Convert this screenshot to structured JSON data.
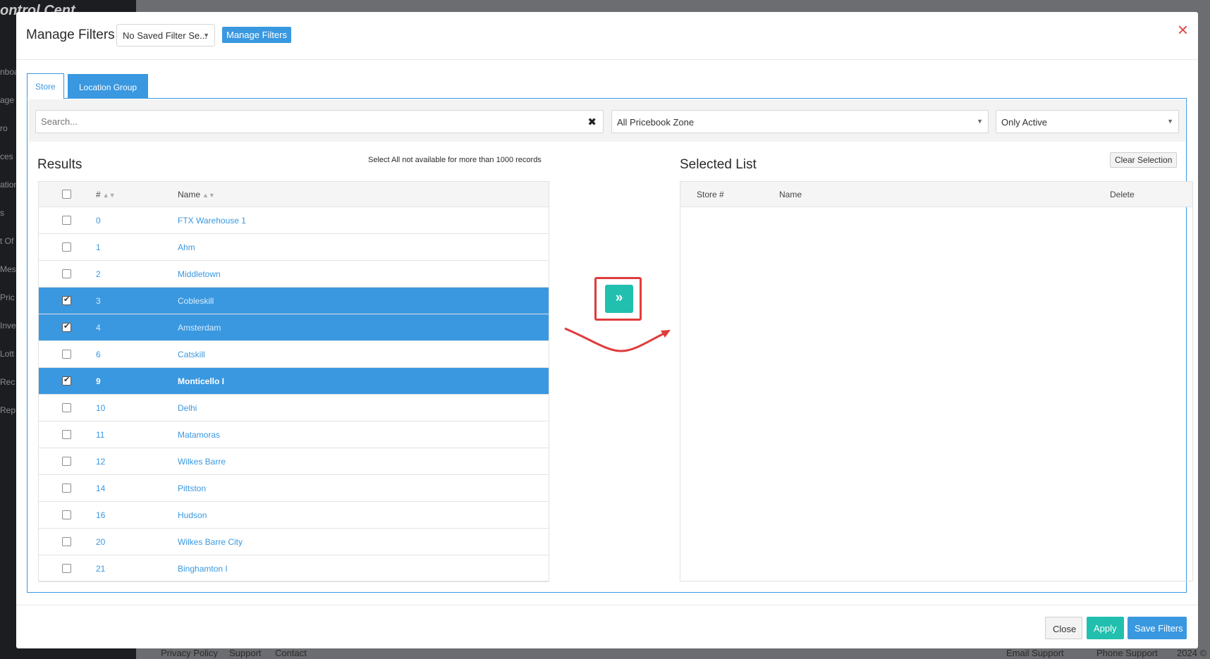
{
  "background": {
    "brand": "ontrol Cent",
    "sidebar_items": [
      "nboa",
      "age",
      "ro",
      "ces",
      "ation",
      "s",
      "t Of",
      "Mes",
      "Pric",
      "Inve",
      "Lott",
      "Rec",
      "Rep"
    ],
    "footer_links": [
      "Privacy Policy",
      "Support",
      "Contact"
    ],
    "footer_right": [
      "Email Support",
      "Phone Support",
      "2024 ©"
    ]
  },
  "modal": {
    "title": "Manage Filters",
    "saved_filter_value": "No Saved Filter Se...",
    "manage_filters_label": "Manage Filters",
    "close_icon": "×"
  },
  "tabs": [
    {
      "label": "Store",
      "active": true
    },
    {
      "label": "Location Group",
      "active": false
    }
  ],
  "filters": {
    "search_placeholder": "Search...",
    "zone_value": "All Pricebook Zone",
    "status_value": "Only Active"
  },
  "results": {
    "title": "Results",
    "note": "Select All not available for more than 1000 records",
    "headers": {
      "number": "#",
      "name": "Name"
    },
    "rows": [
      {
        "num": "0",
        "name": "FTX Warehouse 1",
        "checked": false
      },
      {
        "num": "1",
        "name": "Ahm",
        "checked": false
      },
      {
        "num": "2",
        "name": "Middletown",
        "checked": false
      },
      {
        "num": "3",
        "name": "Cobleskill",
        "checked": true
      },
      {
        "num": "4",
        "name": "Amsterdam",
        "checked": true
      },
      {
        "num": "6",
        "name": "Catskill",
        "checked": false
      },
      {
        "num": "9",
        "name": "Monticello I",
        "checked": true
      },
      {
        "num": "10",
        "name": "Delhi",
        "checked": false
      },
      {
        "num": "11",
        "name": "Matamoras",
        "checked": false
      },
      {
        "num": "12",
        "name": "Wilkes Barre",
        "checked": false
      },
      {
        "num": "14",
        "name": "Pittston",
        "checked": false
      },
      {
        "num": "16",
        "name": "Hudson",
        "checked": false
      },
      {
        "num": "20",
        "name": "Wilkes Barre City",
        "checked": false
      },
      {
        "num": "21",
        "name": "Binghamton I",
        "checked": false
      }
    ]
  },
  "move_button": {
    "glyph": "»"
  },
  "selected_list": {
    "title": "Selected List",
    "clear_label": "Clear Selection",
    "headers": {
      "store": "Store #",
      "name": "Name",
      "delete": "Delete"
    }
  },
  "footer": {
    "close_label": "Close",
    "apply_label": "Apply",
    "save_label": "Save Filters"
  },
  "colors": {
    "primary": "#3a98e0",
    "teal": "#21bfae",
    "danger": "#e03c3c"
  }
}
